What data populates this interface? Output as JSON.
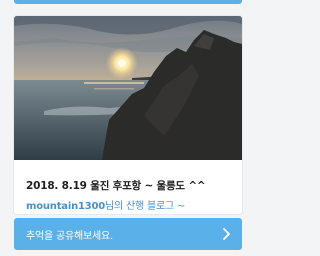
{
  "post": {
    "title": "2018. 8.19 울진 후포항 ~ 울릉도 ^^",
    "author": "mountain1300",
    "author_suffix": "님의 산행 블로그 ~"
  },
  "share": {
    "label": "추억을 공유해보세요."
  },
  "colors": {
    "accent": "#5ab0e8",
    "link": "#4a90c8",
    "title": "#1f1f1f"
  },
  "icons": {
    "share_arrow": "chevron-right-icon"
  }
}
